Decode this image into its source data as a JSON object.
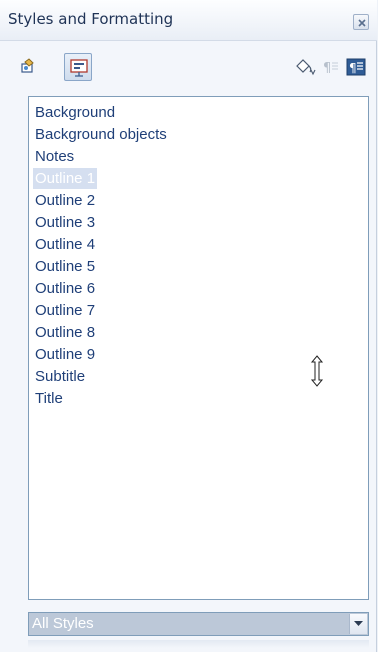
{
  "panel": {
    "title": "Styles and Formatting"
  },
  "toolbar": {
    "buttons": [
      {
        "name": "graphics-styles",
        "icon": "graphics-styles-icon",
        "pressed": false
      },
      {
        "name": "presentation-styles",
        "icon": "presentation-styles-icon",
        "pressed": true
      },
      {
        "name": "fill-format-mode",
        "icon": "paint-bucket-icon",
        "pressed": false
      },
      {
        "name": "new-style-from-selection",
        "icon": "new-style-icon",
        "pressed": false,
        "disabled": true
      },
      {
        "name": "update-style",
        "icon": "update-style-icon",
        "pressed": false
      }
    ]
  },
  "style_list": {
    "items": [
      {
        "label": "Background",
        "selected": false
      },
      {
        "label": "Background objects",
        "selected": false
      },
      {
        "label": "Notes",
        "selected": false
      },
      {
        "label": "Outline 1",
        "selected": true
      },
      {
        "label": "Outline 2",
        "selected": false
      },
      {
        "label": "Outline 3",
        "selected": false
      },
      {
        "label": "Outline 4",
        "selected": false
      },
      {
        "label": "Outline 5",
        "selected": false
      },
      {
        "label": "Outline 6",
        "selected": false
      },
      {
        "label": "Outline 7",
        "selected": false
      },
      {
        "label": "Outline 8",
        "selected": false
      },
      {
        "label": "Outline 9",
        "selected": false
      },
      {
        "label": "Subtitle",
        "selected": false
      },
      {
        "label": "Title",
        "selected": false
      }
    ]
  },
  "filter": {
    "value": "All Styles"
  },
  "colors": {
    "accent_text": "#1f3f78",
    "selection_bg": "#d5dff0",
    "title_text": "#1f3356"
  }
}
